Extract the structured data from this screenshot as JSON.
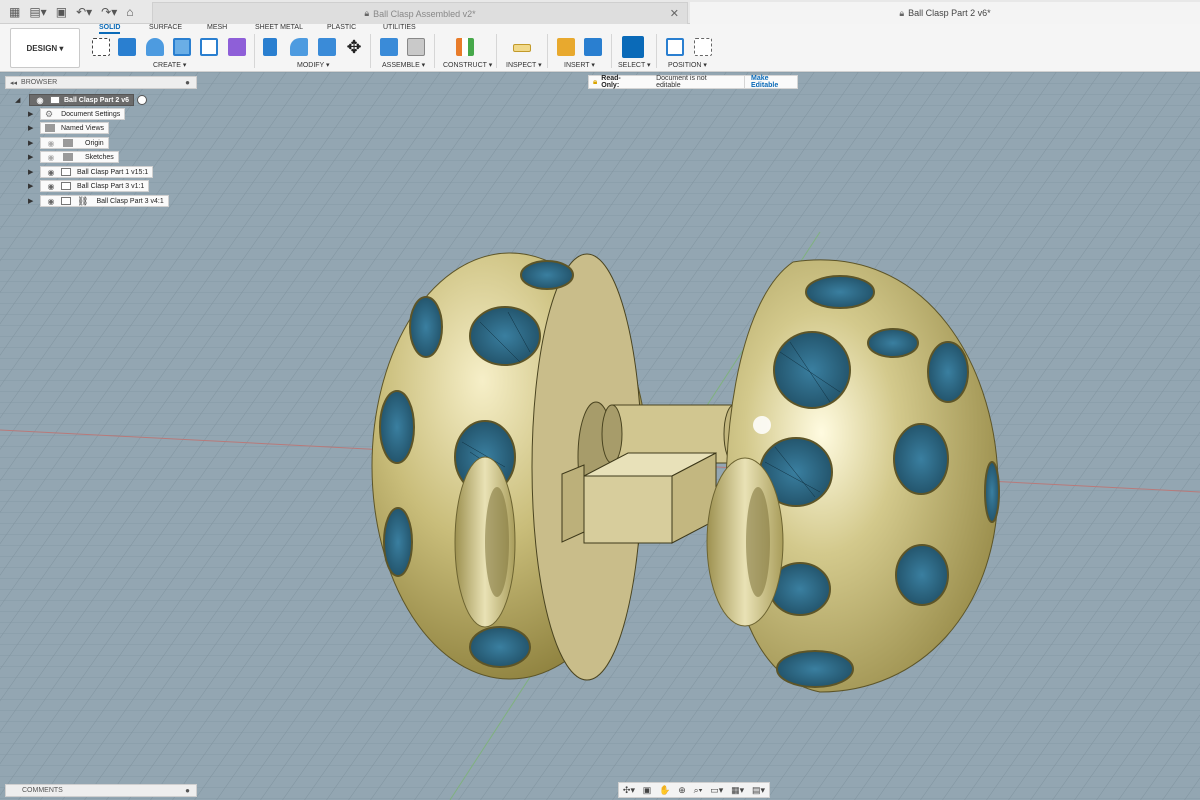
{
  "titlebar": {
    "tabs": [
      {
        "label": "Ball Clasp Assembled v2*"
      },
      {
        "label": "Ball Clasp Part 2 v6*"
      }
    ]
  },
  "ribbon": {
    "design_label": "DESIGN ▾",
    "tabs": [
      "SOLID",
      "SURFACE",
      "MESH",
      "SHEET METAL",
      "PLASTIC",
      "UTILITIES"
    ],
    "groups": [
      "CREATE ▾",
      "MODIFY ▾",
      "ASSEMBLE ▾",
      "CONSTRUCT ▾",
      "INSPECT ▾",
      "INSERT ▾",
      "SELECT ▾",
      "POSITION ▾"
    ]
  },
  "browser": {
    "header": "BROWSER",
    "root": "Ball Clasp Part 2 v6",
    "items": [
      {
        "label": "Document Settings"
      },
      {
        "label": "Named Views"
      },
      {
        "label": "Origin"
      },
      {
        "label": "Sketches"
      },
      {
        "label": "Ball Clasp Part 1 v15:1"
      },
      {
        "label": "Ball Clasp Part 3 v1:1"
      },
      {
        "label": "Ball Clasp Part 3 v4:1"
      }
    ]
  },
  "readonly": {
    "label": "Read-Only:",
    "message": "Document is not editable",
    "button": "Make Editable"
  },
  "comments": {
    "label": "COMMENTS"
  },
  "colors": {
    "viewport_bg": "#93a6b2",
    "gold": "#c9bd7a",
    "accent": "#0a6ab8"
  }
}
